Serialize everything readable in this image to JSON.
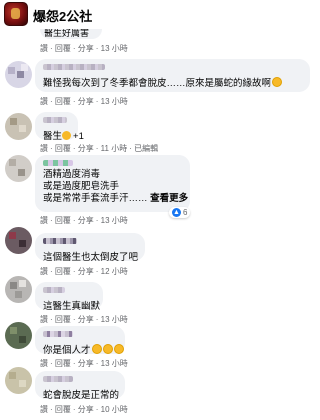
{
  "header": {
    "title": "爆怨2公社"
  },
  "fragment_text": "醫生好厲害",
  "comments": [
    {
      "text": "難怪我每次到了冬季都會脫皮……原來是屬蛇的緣故啊",
      "actions": [
        "讚",
        "回覆",
        "分享",
        "13 小時"
      ]
    },
    {
      "text": "醫生",
      "suffix": "+1",
      "actions": [
        "讚",
        "回覆",
        "分享",
        "11 小時",
        "已編輯"
      ]
    },
    {
      "lines": [
        "酒精過度消毒",
        "或是過度肥皂洗手",
        "或是常常手套流手汗……"
      ],
      "more": "查看更多",
      "reaction_count": "6",
      "actions": [
        "讚",
        "回覆",
        "分享",
        "13 小時"
      ]
    },
    {
      "text": "這個醫生也太倒皮了吧",
      "actions": [
        "讚",
        "回覆",
        "分享",
        "12 小時"
      ]
    },
    {
      "text": "這醫生真幽默",
      "actions": [
        "讚",
        "回覆",
        "分享",
        "13 小時"
      ]
    },
    {
      "text": "你是個人才",
      "actions": [
        "讚",
        "回覆",
        "分享",
        "13 小時"
      ]
    },
    {
      "text": "蛇會脫皮是正常的",
      "actions": [
        "讚",
        "回覆",
        "分享",
        "10 小時"
      ]
    }
  ],
  "top_actions": [
    "讚",
    "回覆",
    "分享",
    "13 小時"
  ]
}
